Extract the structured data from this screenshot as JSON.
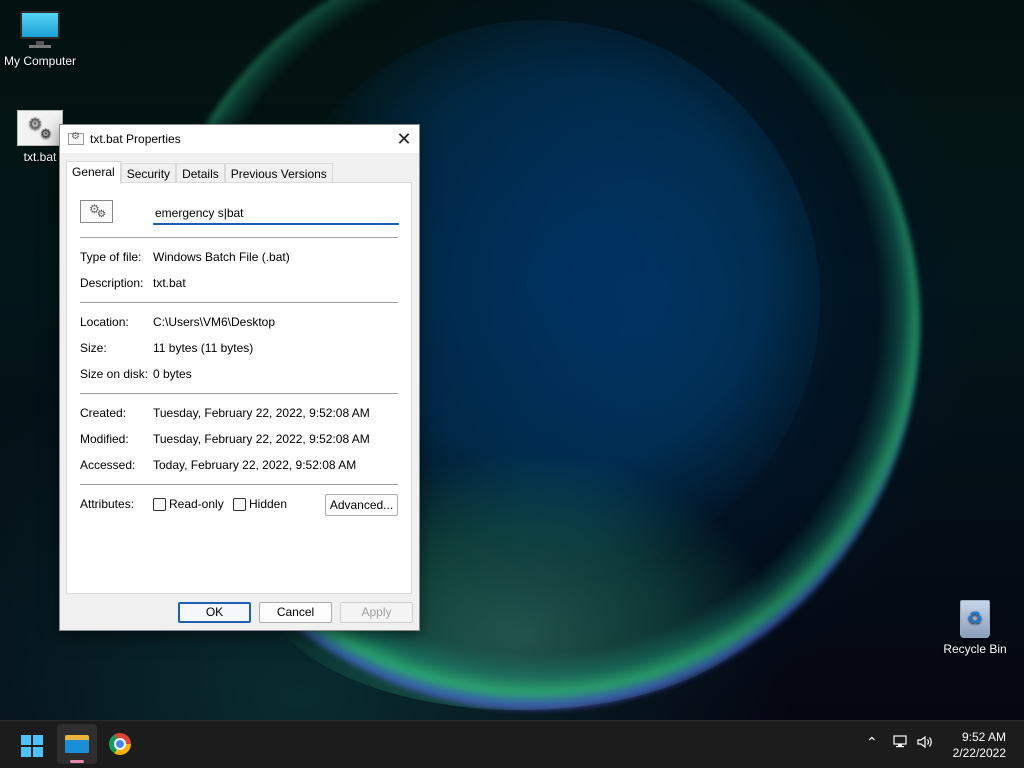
{
  "desktop": {
    "icons": [
      {
        "label": "My Computer",
        "icon": "monitor-icon"
      },
      {
        "label": "txt.bat",
        "icon": "batch-file-icon"
      },
      {
        "label": "Recycle Bin",
        "icon": "recycle-bin-icon"
      }
    ]
  },
  "dialog": {
    "title": "txt.bat Properties",
    "close_symbol": "✕",
    "tabs": [
      {
        "label": "General",
        "active": true
      },
      {
        "label": "Security",
        "active": false
      },
      {
        "label": "Details",
        "active": false
      },
      {
        "label": "Previous Versions",
        "active": false
      }
    ],
    "general": {
      "file_name_value": "emergency s|bat",
      "type_label": "Type of file:",
      "type_value": "Windows Batch File (.bat)",
      "description_label": "Description:",
      "description_value": "txt.bat",
      "location_label": "Location:",
      "location_value": "C:\\Users\\VM6\\Desktop",
      "size_label": "Size:",
      "size_value": "11 bytes (11 bytes)",
      "size_on_disk_label": "Size on disk:",
      "size_on_disk_value": "0 bytes",
      "created_label": "Created:",
      "created_value": "Tuesday, February 22, 2022, 9:52:08 AM",
      "modified_label": "Modified:",
      "modified_value": "Tuesday, February 22, 2022, 9:52:08 AM",
      "accessed_label": "Accessed:",
      "accessed_value": "Today, February 22, 2022, 9:52:08 AM",
      "attributes_label": "Attributes:",
      "readonly_label": "Read-only",
      "readonly_checked": false,
      "hidden_label": "Hidden",
      "hidden_checked": false,
      "advanced_label": "Advanced..."
    },
    "buttons": {
      "ok": "OK",
      "cancel": "Cancel",
      "apply": "Apply",
      "apply_enabled": false
    }
  },
  "taskbar": {
    "apps": [
      {
        "name": "start",
        "icon": "windows-start-icon"
      },
      {
        "name": "file-explorer",
        "icon": "folder-icon",
        "running": true
      },
      {
        "name": "chrome",
        "icon": "chrome-icon"
      }
    ],
    "tray": {
      "chevron_icon": "chevron-up-icon",
      "network_icon": "network-icon",
      "volume_icon": "volume-icon"
    },
    "clock": {
      "time": "9:52 AM",
      "date": "2/22/2022"
    }
  },
  "colors": {
    "accent": "#1d5fb1",
    "taskbar_bg": "#1c1c1c",
    "start_blue": "#4cc2ff"
  }
}
